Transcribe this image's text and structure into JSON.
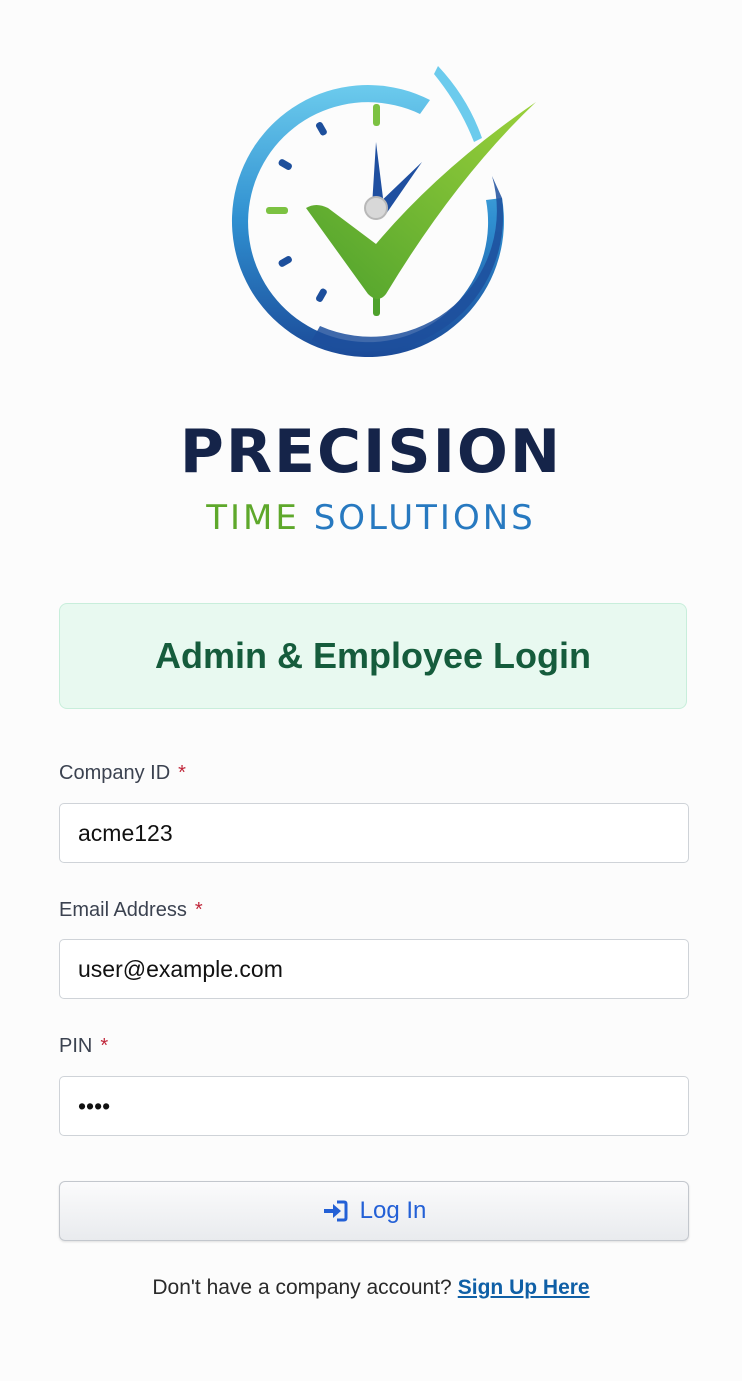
{
  "brand": {
    "name": "PRECISION",
    "tagline_part1": "TIME",
    "tagline_part2": "SOLUTIONS"
  },
  "login": {
    "heading": "Admin & Employee Login"
  },
  "form": {
    "company_id": {
      "label": "Company ID",
      "required_mark": "*",
      "value": "acme123"
    },
    "email": {
      "label": "Email Address",
      "required_mark": "*",
      "value": "user@example.com"
    },
    "pin": {
      "label": "PIN",
      "required_mark": "*",
      "value": "1234"
    },
    "submit_label": "Log In"
  },
  "signup": {
    "prompt": "Don't have a company account?",
    "link_label": "Sign Up Here"
  },
  "icons": {
    "logo": "clock-checkmark-logo",
    "login": "sign-in-icon"
  },
  "colors": {
    "brand_navy": "#152449",
    "brand_green": "#5ea82b",
    "brand_blue": "#2779c0",
    "banner_bg": "#e8f9f0",
    "banner_text": "#155c3c",
    "required": "#c0263a",
    "button_text": "#2360d6",
    "link": "#0f5fa6"
  }
}
